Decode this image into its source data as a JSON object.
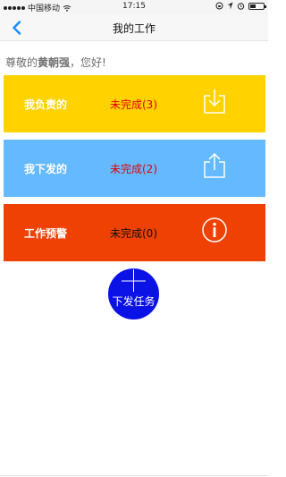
{
  "status_bar": {
    "carrier": "中国移动",
    "time": "17:15",
    "battery_level": 0.45
  },
  "nav": {
    "title": "我的工作",
    "back_icon": "chevron-left-icon"
  },
  "greeting": {
    "prefix": "尊敬的",
    "name": "黄朝强",
    "suffix": "，您好!"
  },
  "cards": [
    {
      "label": "我负责的",
      "status": "未完成(3)",
      "status_color": "#e40000",
      "icon": "download-icon",
      "bg": "#ffd200"
    },
    {
      "label": "我下发的",
      "status": "未完成(2)",
      "status_color": "#e40000",
      "icon": "upload-icon",
      "bg": "#64b9ff"
    },
    {
      "label": "工作预警",
      "status": "未完成(0)",
      "status_color": "#111111",
      "icon": "info-icon",
      "bg": "#ee4103"
    }
  ],
  "fab": {
    "label": "下发任务",
    "color": "#0b12e6"
  }
}
